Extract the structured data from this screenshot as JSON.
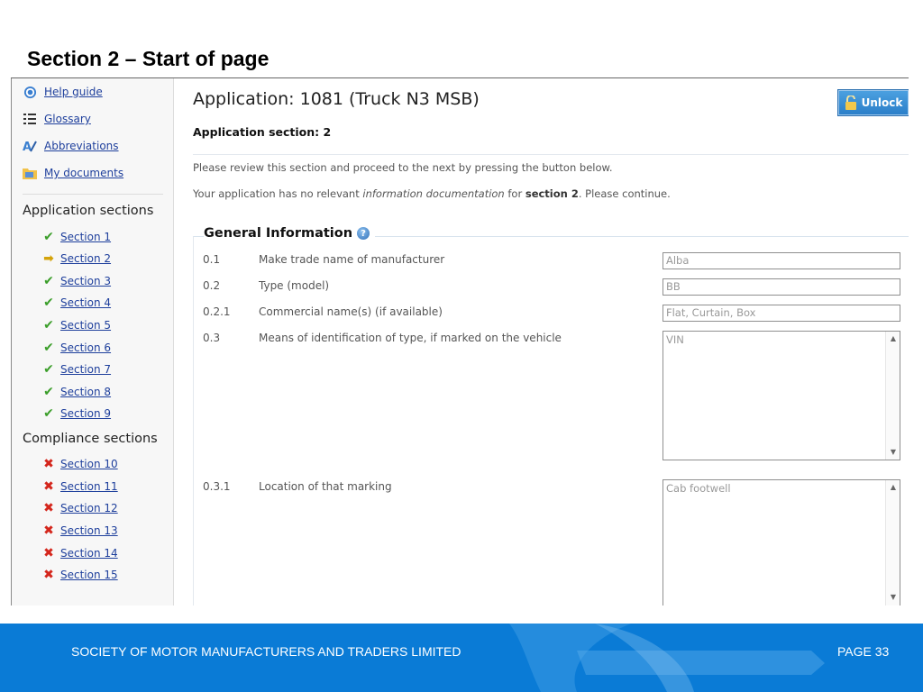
{
  "slide": {
    "title": "Section 2 – Start of page"
  },
  "sidebar": {
    "tools": [
      {
        "label": "Help guide",
        "icon": "help-icon"
      },
      {
        "label": "Glossary",
        "icon": "glossary-icon"
      },
      {
        "label": "Abbreviations",
        "icon": "abbreviations-icon"
      },
      {
        "label": "My documents",
        "icon": "folder-icon"
      }
    ],
    "application_heading": "Application sections",
    "application_sections": [
      {
        "label": "Section 1",
        "status": "complete"
      },
      {
        "label": "Section 2",
        "status": "current"
      },
      {
        "label": "Section 3",
        "status": "complete"
      },
      {
        "label": "Section 4",
        "status": "complete"
      },
      {
        "label": "Section 5",
        "status": "complete"
      },
      {
        "label": "Section 6",
        "status": "complete"
      },
      {
        "label": "Section 7",
        "status": "complete"
      },
      {
        "label": "Section 8",
        "status": "complete"
      },
      {
        "label": "Section 9",
        "status": "complete"
      }
    ],
    "compliance_heading": "Compliance sections",
    "compliance_sections": [
      {
        "label": "Section 10",
        "status": "incomplete"
      },
      {
        "label": "Section 11",
        "status": "incomplete"
      },
      {
        "label": "Section 12",
        "status": "incomplete"
      },
      {
        "label": "Section 13",
        "status": "incomplete"
      },
      {
        "label": "Section 14",
        "status": "incomplete"
      },
      {
        "label": "Section 15",
        "status": "incomplete"
      }
    ]
  },
  "main": {
    "title": "Application: 1081 (Truck N3 MSB)",
    "subtitle": "Application section: 2",
    "unlock_label": "Unlock",
    "instruction": "Please review this section and proceed to the next by pressing the button below.",
    "notice": {
      "prefix": "Your application has no relevant ",
      "italic": "information documentation",
      "middle": " for ",
      "bold": "section 2",
      "suffix": ". Please continue."
    },
    "general_info": {
      "title": "General Information",
      "fields": [
        {
          "number": "0.1",
          "label": "Make trade name of manufacturer",
          "value": "Alba"
        },
        {
          "number": "0.2",
          "label": "Type (model)",
          "value": "BB"
        },
        {
          "number": "0.2.1",
          "label": "Commercial name(s) (if available)",
          "value": "Flat, Curtain, Box"
        },
        {
          "number": "0.3",
          "label": "Means of identification of type, if marked on the vehicle",
          "value": "VIN"
        },
        {
          "number": "0.3.1",
          "label": "Location of that marking",
          "value": "Cab footwell"
        }
      ]
    }
  },
  "footer": {
    "organization": "SOCIETY OF MOTOR MANUFACTURERS AND TRADERS LIMITED",
    "page": "PAGE 33"
  },
  "colors": {
    "footer_blue": "#0a7bd6",
    "link_blue": "#1e3f9c",
    "complete_green": "#3b9e2a",
    "current_yellow": "#d4a30a",
    "incomplete_red": "#d4261c"
  }
}
